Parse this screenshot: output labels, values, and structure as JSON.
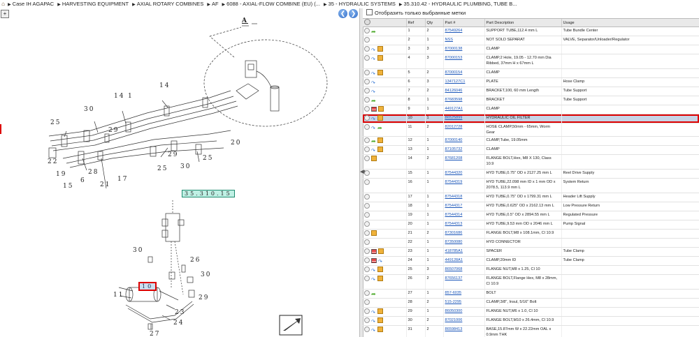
{
  "breadcrumb": {
    "home_icon": "home-icon",
    "items": [
      "Case IH AGAPAC",
      "HARVESTING EQUIPMENT",
      "AXIAL ROTARY COMBINES",
      "AF",
      "6088 - AXIAL-FLOW COMBINE (EU) (...",
      "35 - HYDRAULIC SYSTEMS",
      "35.310.42 - HYDRAULIC PLUMBING, TUBE B..."
    ]
  },
  "diagram": {
    "section_label": "A",
    "callouts": [
      "14",
      "14",
      "1",
      "30",
      "25",
      "29",
      "20",
      "22",
      "19",
      "15",
      "6",
      "21",
      "28",
      "17",
      "29",
      "25",
      "30",
      "25",
      "30",
      "26",
      "30",
      "11",
      "29",
      "23",
      "27",
      "24"
    ],
    "highlight_top": "35.310.15",
    "highlight_bottom": "10",
    "nav_prev_icon": "arrow-left-icon",
    "nav_next_icon": "arrow-right-icon"
  },
  "filter": {
    "label": "Отобразить только выбранные метки"
  },
  "table": {
    "headers": [
      "",
      "Ref",
      "Qty",
      "Part #",
      "Part Description",
      "Usage"
    ],
    "rows": [
      {
        "icons": [
          "add",
          "arr"
        ],
        "ref": "1",
        "qty": "2",
        "part": "87549264",
        "desc": "SUPPORT TUBE,112.4 mm L",
        "usage": "Tube Bundle Center",
        "tall": false
      },
      {
        "icons": [
          "add"
        ],
        "ref": "2",
        "qty": "1",
        "part": "NSS",
        "desc": "NOT SOLD SEPARAT",
        "usage": "VALVE, Separator/Unloader/Regulator",
        "tall": false
      },
      {
        "icons": [
          "add",
          "info",
          "box"
        ],
        "ref": "3",
        "qty": "3",
        "part": "87000138",
        "desc": "CLAMP",
        "usage": "",
        "tall": false
      },
      {
        "icons": [
          "add",
          "info",
          "box"
        ],
        "ref": "4",
        "qty": "3",
        "part": "87000153",
        "desc": "CLAMP,2 Hole, 19.05 - 12.70 mm Dia Ribbed, 37mm H x 67mm L",
        "usage": "",
        "tall": true
      },
      {
        "icons": [
          "add",
          "info",
          "box"
        ],
        "ref": "5",
        "qty": "2",
        "part": "87000154",
        "desc": "CLAMP",
        "usage": "",
        "tall": false
      },
      {
        "icons": [
          "add",
          "info"
        ],
        "ref": "6",
        "qty": "3",
        "part": "1347127C1",
        "desc": "PLATE",
        "usage": "Hose Clamp",
        "tall": false
      },
      {
        "icons": [
          "add",
          "info"
        ],
        "ref": "7",
        "qty": "2",
        "part": "84126046",
        "desc": "BRACKET,100, 60 mm Length",
        "usage": "Tube Support",
        "tall": false
      },
      {
        "icons": [
          "add",
          "arr"
        ],
        "ref": "8",
        "qty": "1",
        "part": "87683598",
        "desc": "BRACKET",
        "usage": "Tube Support",
        "tall": false
      },
      {
        "icons": [
          "add",
          "flag",
          "box"
        ],
        "ref": "9",
        "qty": "1",
        "part": "449127A1",
        "desc": "CLAMP",
        "usage": "",
        "tall": false
      },
      {
        "icons": [
          "add",
          "info",
          "box"
        ],
        "ref": "10",
        "qty": "1",
        "part": "86525899",
        "desc": "HYDRAULIC OIL FILTER",
        "usage": "",
        "tall": false,
        "selected": true
      },
      {
        "icons": [
          "add",
          "info",
          "arr"
        ],
        "ref": "11",
        "qty": "2",
        "part": "82012728",
        "desc": "HOSE CLAMP,50mm - 65mm, Worm Gear",
        "usage": "",
        "tall": false
      },
      {
        "icons": [
          "add",
          "arr",
          "box"
        ],
        "ref": "12",
        "qty": "1",
        "part": "87000140",
        "desc": "CLAMP,Tube, 19.05mm",
        "usage": "",
        "tall": false
      },
      {
        "icons": [
          "add",
          "info",
          "box"
        ],
        "ref": "13",
        "qty": "1",
        "part": "87105732",
        "desc": "CLAMP",
        "usage": "",
        "tall": false
      },
      {
        "icons": [
          "add",
          "box"
        ],
        "ref": "14",
        "qty": "2",
        "part": "87681208",
        "desc": "FLANGE BOLT,Hex, M8 X 130, Class 10.9",
        "usage": "",
        "tall": true
      },
      {
        "icons": [
          "add"
        ],
        "ref": "15",
        "qty": "1",
        "part": "87544320",
        "desc": "HYD TUBE,0.75\" OD x 2127.25 mm L",
        "usage": "Reel Drive Supply",
        "tall": false
      },
      {
        "icons": [
          "add"
        ],
        "ref": "16",
        "qty": "1",
        "part": "87544319",
        "desc": "HYD TUBE,22.098 mm ID x 1 mm OD x 2078.5, 113.9 mm L",
        "usage": "System Return",
        "tall": true
      },
      {
        "icons": [
          "add"
        ],
        "ref": "17",
        "qty": "1",
        "part": "87544318",
        "desc": "HYD TUBE,0.75\" OD x 1799.31 mm L",
        "usage": "Header Lift Supply",
        "tall": false
      },
      {
        "icons": [
          "add"
        ],
        "ref": "18",
        "qty": "1",
        "part": "87544317",
        "desc": "HYD TUBE,0.625\" OD x 2162.13 mm L",
        "usage": "Low Pressure Return",
        "tall": false
      },
      {
        "icons": [
          "add"
        ],
        "ref": "19",
        "qty": "1",
        "part": "87544314",
        "desc": "HYD TUBE,0.5\" OD x 2894.55 mm L",
        "usage": "Regulated Pressure",
        "tall": false
      },
      {
        "icons": [
          "add"
        ],
        "ref": "20",
        "qty": "1",
        "part": "87544313",
        "desc": "HYD TUBE,9.53 mm OD x 2046 mm L",
        "usage": "Pump Signal",
        "tall": false
      },
      {
        "icons": [
          "add",
          "box"
        ],
        "ref": "21",
        "qty": "2",
        "part": "87301686",
        "desc": "FLANGE BOLT,M8 x 108.1mm, Cl 10.9",
        "usage": "",
        "tall": false
      },
      {
        "icons": [
          "add"
        ],
        "ref": "22",
        "qty": "1",
        "part": "87350080",
        "desc": "HYD CONNECTOR",
        "usage": "",
        "tall": false
      },
      {
        "icons": [
          "add",
          "flag",
          "box"
        ],
        "ref": "23",
        "qty": "1",
        "part": "418785A1",
        "desc": "SPACER",
        "usage": "Tube Clamp",
        "tall": false
      },
      {
        "icons": [
          "add",
          "flag",
          "info"
        ],
        "ref": "24",
        "qty": "1",
        "part": "449128A1",
        "desc": "CLAMP,20mm ID",
        "usage": "Tube Clamp",
        "tall": false
      },
      {
        "icons": [
          "add",
          "info",
          "box"
        ],
        "ref": "25",
        "qty": "3",
        "part": "86507068",
        "desc": "FLANGE NUT,M8 x 1.25, Cl 10",
        "usage": "",
        "tall": false
      },
      {
        "icons": [
          "add",
          "info",
          "box"
        ],
        "ref": "26",
        "qty": "2",
        "part": "87656137",
        "desc": "FLANGE BOLT,Flange Hex, M8 x 28mm, Cl 10.9",
        "usage": "",
        "tall": true
      },
      {
        "icons": [
          "add",
          "arr"
        ],
        "ref": "27",
        "qty": "1",
        "part": "857-6035",
        "desc": "BOLT",
        "usage": "",
        "tall": false
      },
      {
        "icons": [
          "add"
        ],
        "ref": "28",
        "qty": "2",
        "part": "515-2295",
        "desc": "CLAMP,3/8\", Insul, 5/16\" Bolt",
        "usage": "",
        "tall": false
      },
      {
        "icons": [
          "add",
          "info",
          "box"
        ],
        "ref": "29",
        "qty": "1",
        "part": "86050300",
        "desc": "FLANGE NUT,M6 x 1.0, Cl 10",
        "usage": "",
        "tall": false
      },
      {
        "icons": [
          "add",
          "info",
          "box"
        ],
        "ref": "30",
        "qty": "2",
        "part": "87021006",
        "desc": "FLANGE BOLT,M10 x 26.4mm, Cl 10.9",
        "usage": "",
        "tall": false
      },
      {
        "icons": [
          "add",
          "info",
          "box"
        ],
        "ref": "31",
        "qty": "2",
        "part": "86598413",
        "desc": "BASE,15.87mm W x 22.22mm OAL x 0.9mm THK",
        "usage": "",
        "tall": true
      }
    ]
  }
}
